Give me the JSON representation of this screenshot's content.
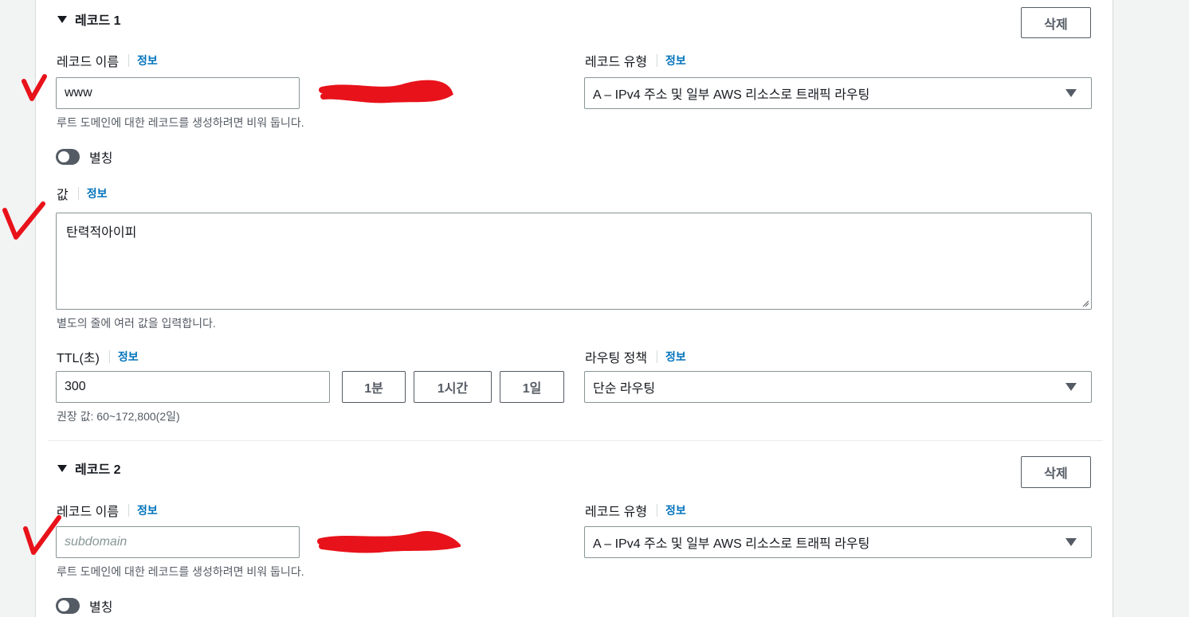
{
  "records": [
    {
      "title": "레코드 1",
      "delete_label": "삭제",
      "name_label": "레코드 이름",
      "info": "정보",
      "name_value": "www",
      "name_placeholder": "",
      "name_hint": "루트 도메인에 대한 레코드를 생성하려면 비워 둡니다.",
      "type_label": "레코드 유형",
      "type_value": "A – IPv4 주소 및 일부 AWS 리소스로 트래픽 라우팅",
      "alias_label": "별칭",
      "value_label": "값",
      "value_text": "탄력적아이피",
      "value_hint": "별도의 줄에 여러 값을 입력합니다.",
      "ttl_label": "TTL(초)",
      "ttl_value": "300",
      "ttl_hint": "권장 값: 60~172,800(2일)",
      "ttl_buttons": [
        "1분",
        "1시간",
        "1일"
      ],
      "routing_label": "라우팅 정책",
      "routing_value": "단순 라우팅"
    },
    {
      "title": "레코드 2",
      "delete_label": "삭제",
      "name_label": "레코드 이름",
      "info": "정보",
      "name_value": "",
      "name_placeholder": "subdomain",
      "name_hint": "루트 도메인에 대한 레코드를 생성하려면 비워 둡니다.",
      "type_label": "레코드 유형",
      "type_value": "A – IPv4 주소 및 일부 AWS 리소스로 트래픽 라우팅",
      "alias_label": "별칭"
    }
  ],
  "colors": {
    "annotation": "#e8121a",
    "link": "#0073bb"
  }
}
